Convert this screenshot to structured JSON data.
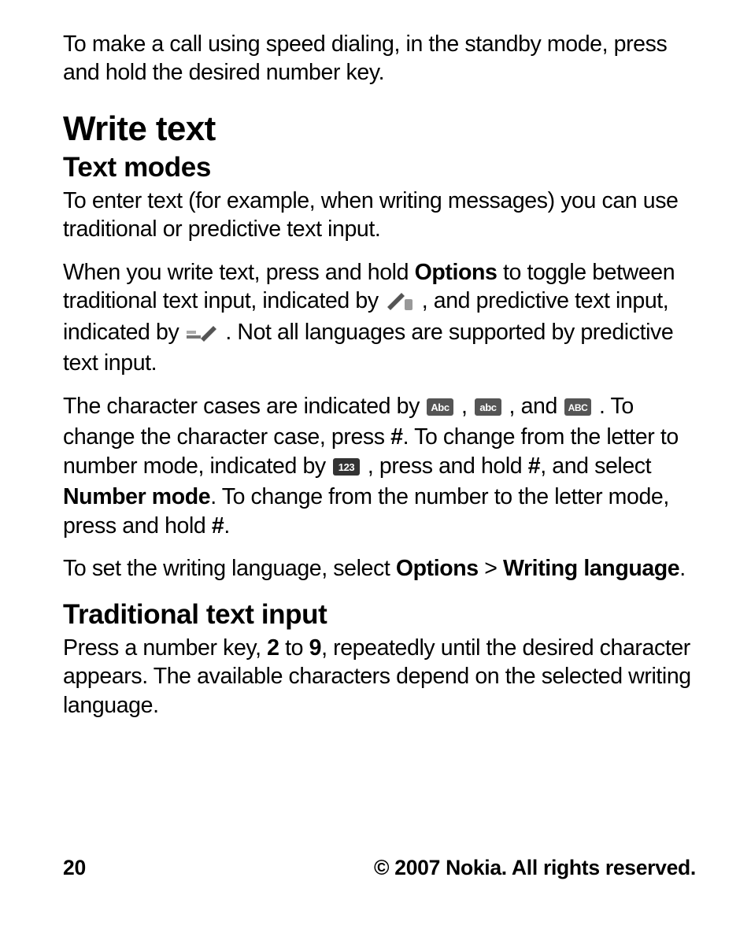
{
  "intro": "To make a call using speed dialing, in the standby mode, press and hold the desired number key.",
  "h1": "Write text",
  "h2a": "Text modes",
  "p1": "To enter text (for example, when writing messages) you can use traditional or predictive text input.",
  "p2": {
    "t1": "When you write text, press and hold ",
    "b1": "Options",
    "t2": " to toggle between traditional text input, indicated by ",
    "t3": " , and predictive text input, indicated by ",
    "t4": " . Not all languages are supported by predictive text input."
  },
  "p3": {
    "t1": "The character cases are indicated by ",
    "t2": " , ",
    "t3": " , and ",
    "t4": " . To change the character case, press ",
    "b1": "#",
    "t5": ". To change from the letter to number mode, indicated by ",
    "t6": " , press and hold ",
    "b2": "#",
    "t7": ", and select ",
    "b3": "Number mode",
    "t8": ". To change from the number to the letter mode, press and hold ",
    "b4": "#",
    "t9": "."
  },
  "p4": {
    "t1": "To set the writing language, select ",
    "b1": "Options",
    "sep": " > ",
    "b2": "Writing language",
    "t2": "."
  },
  "h2b": "Traditional text input",
  "p5": {
    "t1": "Press a number key, ",
    "b1": "2",
    "t2": " to ",
    "b2": "9",
    "t3": ", repeatedly until the desired character appears. The available characters depend on the selected writing language."
  },
  "footer": {
    "page": "20",
    "copyright": "© 2007 Nokia. All rights reserved."
  }
}
